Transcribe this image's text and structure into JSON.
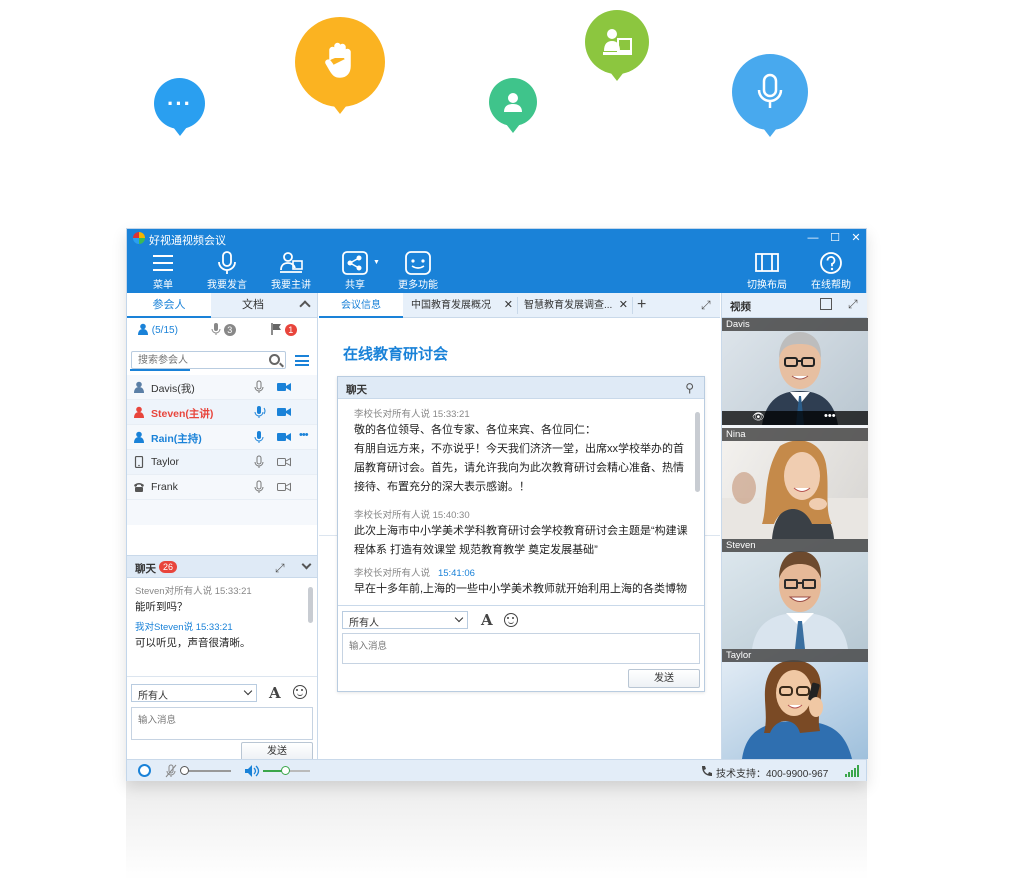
{
  "bubbles": [
    {
      "name": "chat-bubble",
      "color": "#2a9ff0",
      "glyph": "···"
    },
    {
      "name": "raise-hand-bubble",
      "color": "#fbb321",
      "icon": "hand-icon"
    },
    {
      "name": "user-bubble",
      "color": "#3fc48b",
      "icon": "user-icon"
    },
    {
      "name": "presenter-bubble",
      "color": "#8cc63f",
      "icon": "presenter-icon"
    },
    {
      "name": "mic-bubble",
      "color": "#48a9ee",
      "icon": "mic-icon"
    }
  ],
  "window": {
    "title": "好视通视频会议",
    "accent": "#1a82d8"
  },
  "toolbar": {
    "menu": "菜单",
    "speak": "我要发言",
    "host": "我要主讲",
    "share": "共享",
    "more": "更多功能",
    "layout": "切换布局",
    "help": "在线帮助"
  },
  "left": {
    "tab_participants": "参会人",
    "tab_docs": "文档",
    "count": "(5/15)",
    "mic_count": "3",
    "hand_count": "1",
    "search_placeholder": "搜索参会人",
    "participants": [
      {
        "name": "Davis(我)",
        "role": "normal"
      },
      {
        "name": "Steven(主讲)",
        "role": "presenter"
      },
      {
        "name": "Rain(主持)",
        "role": "host"
      },
      {
        "name": "Taylor",
        "role": "mobile"
      },
      {
        "name": "Frank",
        "role": "phone"
      }
    ],
    "chat": {
      "title": "聊天",
      "count": "26",
      "messages": [
        {
          "meta": "Steven对所有人说  15:33:21",
          "text": "能听到吗？"
        },
        {
          "meta": "我对Steven说  15:33:21",
          "text": "可以听见，声音很清晰。"
        }
      ],
      "recipient": "所有人",
      "input_placeholder": "输入消息",
      "send": "发送"
    }
  },
  "center": {
    "tabs": [
      {
        "label": "会议信息"
      },
      {
        "label": "中国教育发展概况"
      },
      {
        "label": "智慧教育发展调查..."
      }
    ],
    "meeting_title": "在线教育研讨会",
    "chat": {
      "title": "聊天",
      "messages": [
        {
          "meta": "李校长对所有人说  15:33:21",
          "text": "敬的各位领导、各位专家、各位来宾、各位同仁：\n有朋自远方来，不亦说乎！今天我们济济一堂，出席xx学校举办的首届教育研讨会。首先，请允许我向为此次教育研讨会精心准备、热情接待、布置充分的深大表示感谢。！"
        },
        {
          "meta": "李校长对所有人说  15:40:30",
          "text": "此次上海市中小学美术学科教育研讨会学校教育研讨会主题是“构建课程体系 打造有效课堂 规范教育教学 奠定发展基础”"
        },
        {
          "meta": "李校长对所有人说",
          "time": "15:41:06",
          "text": "早在十多年前,上海的一些中小学美术教师就开始利用上海的各类博物"
        }
      ],
      "recipient": "所有人",
      "input_placeholder": "输入消息",
      "send": "发送"
    }
  },
  "right": {
    "title": "视频",
    "videos": [
      {
        "name": "Davis"
      },
      {
        "name": "Nina"
      },
      {
        "name": "Steven"
      },
      {
        "name": "Taylor"
      }
    ]
  },
  "status": {
    "support": "技术支持：400-9900-967"
  }
}
